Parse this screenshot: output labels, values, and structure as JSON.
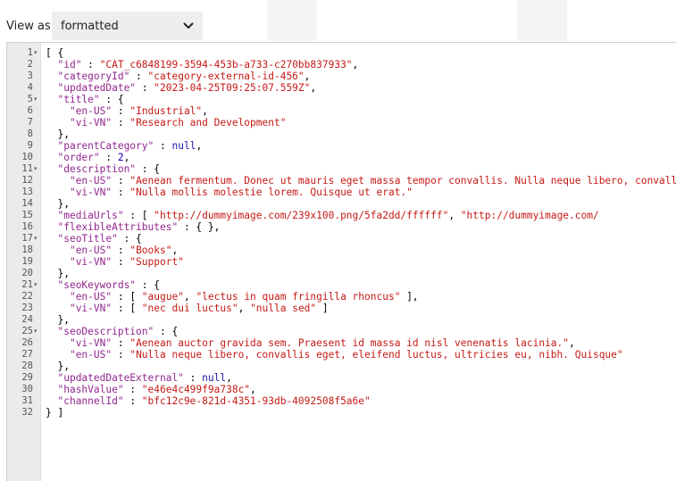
{
  "toolbar": {
    "view_as_label": "View as:",
    "view_select_value": "formatted",
    "view_select_icon": "chevron-down-icon"
  },
  "editor": {
    "fold_marker": "▾",
    "lines": [
      {
        "n": "1",
        "fold": true,
        "tokens": [
          [
            "p",
            "[ {"
          ]
        ]
      },
      {
        "n": "2",
        "fold": false,
        "tokens": [
          [
            "p",
            "  "
          ],
          [
            "k",
            "\"id\""
          ],
          [
            "p",
            " : "
          ],
          [
            "s",
            "\"CAT_c6848199-3594-453b-a733-c270bb837933\""
          ],
          [
            "p",
            ","
          ]
        ]
      },
      {
        "n": "3",
        "fold": false,
        "tokens": [
          [
            "p",
            "  "
          ],
          [
            "k",
            "\"categoryId\""
          ],
          [
            "p",
            " : "
          ],
          [
            "s",
            "\"category-external-id-456\""
          ],
          [
            "p",
            ","
          ]
        ]
      },
      {
        "n": "4",
        "fold": false,
        "tokens": [
          [
            "p",
            "  "
          ],
          [
            "k",
            "\"updatedDate\""
          ],
          [
            "p",
            " : "
          ],
          [
            "s",
            "\"2023-04-25T09:25:07.559Z\""
          ],
          [
            "p",
            ","
          ]
        ]
      },
      {
        "n": "5",
        "fold": true,
        "tokens": [
          [
            "p",
            "  "
          ],
          [
            "k",
            "\"title\""
          ],
          [
            "p",
            " : {"
          ]
        ]
      },
      {
        "n": "6",
        "fold": false,
        "tokens": [
          [
            "p",
            "    "
          ],
          [
            "k",
            "\"en-US\""
          ],
          [
            "p",
            " : "
          ],
          [
            "s",
            "\"Industrial\""
          ],
          [
            "p",
            ","
          ]
        ]
      },
      {
        "n": "7",
        "fold": false,
        "tokens": [
          [
            "p",
            "    "
          ],
          [
            "k",
            "\"vi-VN\""
          ],
          [
            "p",
            " : "
          ],
          [
            "s",
            "\"Research and Development\""
          ]
        ]
      },
      {
        "n": "8",
        "fold": false,
        "tokens": [
          [
            "p",
            "  },"
          ]
        ]
      },
      {
        "n": "9",
        "fold": false,
        "tokens": [
          [
            "p",
            "  "
          ],
          [
            "k",
            "\"parentCategory\""
          ],
          [
            "p",
            " : "
          ],
          [
            "w",
            "null"
          ],
          [
            "p",
            ","
          ]
        ]
      },
      {
        "n": "10",
        "fold": false,
        "tokens": [
          [
            "p",
            "  "
          ],
          [
            "k",
            "\"order\""
          ],
          [
            "p",
            " : "
          ],
          [
            "n",
            "2"
          ],
          [
            "p",
            ","
          ]
        ]
      },
      {
        "n": "11",
        "fold": true,
        "tokens": [
          [
            "p",
            "  "
          ],
          [
            "k",
            "\"description\""
          ],
          [
            "p",
            " : {"
          ]
        ]
      },
      {
        "n": "12",
        "fold": false,
        "tokens": [
          [
            "p",
            "    "
          ],
          [
            "k",
            "\"en-US\""
          ],
          [
            "p",
            " : "
          ],
          [
            "s",
            "\"Aenean fermentum. Donec ut mauris eget massa tempor convallis. Nulla neque libero, convallis eget, eleifend luctus, ultricies eu, nibh.\""
          ],
          [
            "p",
            ","
          ]
        ]
      },
      {
        "n": "13",
        "fold": false,
        "tokens": [
          [
            "p",
            "    "
          ],
          [
            "k",
            "\"vi-VN\""
          ],
          [
            "p",
            " : "
          ],
          [
            "s",
            "\"Nulla mollis molestie lorem. Quisque ut erat.\""
          ]
        ]
      },
      {
        "n": "14",
        "fold": false,
        "tokens": [
          [
            "p",
            "  },"
          ]
        ]
      },
      {
        "n": "15",
        "fold": false,
        "tokens": [
          [
            "p",
            "  "
          ],
          [
            "k",
            "\"mediaUrls\""
          ],
          [
            "p",
            " : [ "
          ],
          [
            "s",
            "\"http://dummyimage.com/239x100.png/5fa2dd/ffffff\""
          ],
          [
            "p",
            ", "
          ],
          [
            "s",
            "\"http://dummyimage.com/"
          ]
        ]
      },
      {
        "n": "16",
        "fold": false,
        "tokens": [
          [
            "p",
            "  "
          ],
          [
            "k",
            "\"flexibleAttributes\""
          ],
          [
            "p",
            " : { },"
          ]
        ]
      },
      {
        "n": "17",
        "fold": true,
        "tokens": [
          [
            "p",
            "  "
          ],
          [
            "k",
            "\"seoTitle\""
          ],
          [
            "p",
            " : {"
          ]
        ]
      },
      {
        "n": "18",
        "fold": false,
        "tokens": [
          [
            "p",
            "    "
          ],
          [
            "k",
            "\"en-US\""
          ],
          [
            "p",
            " : "
          ],
          [
            "s",
            "\"Books\""
          ],
          [
            "p",
            ","
          ]
        ]
      },
      {
        "n": "19",
        "fold": false,
        "tokens": [
          [
            "p",
            "    "
          ],
          [
            "k",
            "\"vi-VN\""
          ],
          [
            "p",
            " : "
          ],
          [
            "s",
            "\"Support\""
          ]
        ]
      },
      {
        "n": "20",
        "fold": false,
        "tokens": [
          [
            "p",
            "  },"
          ]
        ]
      },
      {
        "n": "21",
        "fold": true,
        "tokens": [
          [
            "p",
            "  "
          ],
          [
            "k",
            "\"seoKeywords\""
          ],
          [
            "p",
            " : {"
          ]
        ]
      },
      {
        "n": "22",
        "fold": false,
        "tokens": [
          [
            "p",
            "    "
          ],
          [
            "k",
            "\"en-US\""
          ],
          [
            "p",
            " : [ "
          ],
          [
            "s",
            "\"augue\""
          ],
          [
            "p",
            ", "
          ],
          [
            "s",
            "\"lectus in quam fringilla rhoncus\""
          ],
          [
            "p",
            " ],"
          ]
        ]
      },
      {
        "n": "23",
        "fold": false,
        "tokens": [
          [
            "p",
            "    "
          ],
          [
            "k",
            "\"vi-VN\""
          ],
          [
            "p",
            " : [ "
          ],
          [
            "s",
            "\"nec dui luctus\""
          ],
          [
            "p",
            ", "
          ],
          [
            "s",
            "\"nulla sed\""
          ],
          [
            "p",
            " ]"
          ]
        ]
      },
      {
        "n": "24",
        "fold": false,
        "tokens": [
          [
            "p",
            "  },"
          ]
        ]
      },
      {
        "n": "25",
        "fold": true,
        "tokens": [
          [
            "p",
            "  "
          ],
          [
            "k",
            "\"seoDescription\""
          ],
          [
            "p",
            " : {"
          ]
        ]
      },
      {
        "n": "26",
        "fold": false,
        "tokens": [
          [
            "p",
            "    "
          ],
          [
            "k",
            "\"vi-VN\""
          ],
          [
            "p",
            " : "
          ],
          [
            "s",
            "\"Aenean auctor gravida sem. Praesent id massa id nisl venenatis lacinia.\""
          ],
          [
            "p",
            ","
          ]
        ]
      },
      {
        "n": "27",
        "fold": false,
        "tokens": [
          [
            "p",
            "    "
          ],
          [
            "k",
            "\"en-US\""
          ],
          [
            "p",
            " : "
          ],
          [
            "s",
            "\"Nulla neque libero, convallis eget, eleifend luctus, ultricies eu, nibh. Quisque\""
          ]
        ]
      },
      {
        "n": "28",
        "fold": false,
        "tokens": [
          [
            "p",
            "  },"
          ]
        ]
      },
      {
        "n": "29",
        "fold": false,
        "tokens": [
          [
            "p",
            "  "
          ],
          [
            "k",
            "\"updatedDateExternal\""
          ],
          [
            "p",
            " : "
          ],
          [
            "w",
            "null"
          ],
          [
            "p",
            ","
          ]
        ]
      },
      {
        "n": "30",
        "fold": false,
        "tokens": [
          [
            "p",
            "  "
          ],
          [
            "k",
            "\"hashValue\""
          ],
          [
            "p",
            " : "
          ],
          [
            "s",
            "\"e46e4c499f9a738c\""
          ],
          [
            "p",
            ","
          ]
        ]
      },
      {
        "n": "31",
        "fold": false,
        "tokens": [
          [
            "p",
            "  "
          ],
          [
            "k",
            "\"channelId\""
          ],
          [
            "p",
            " : "
          ],
          [
            "s",
            "\"bfc12c9e-821d-4351-93db-4092508f5a6e\""
          ]
        ]
      },
      {
        "n": "32",
        "fold": false,
        "tokens": [
          [
            "p",
            "} ]"
          ]
        ]
      }
    ]
  }
}
